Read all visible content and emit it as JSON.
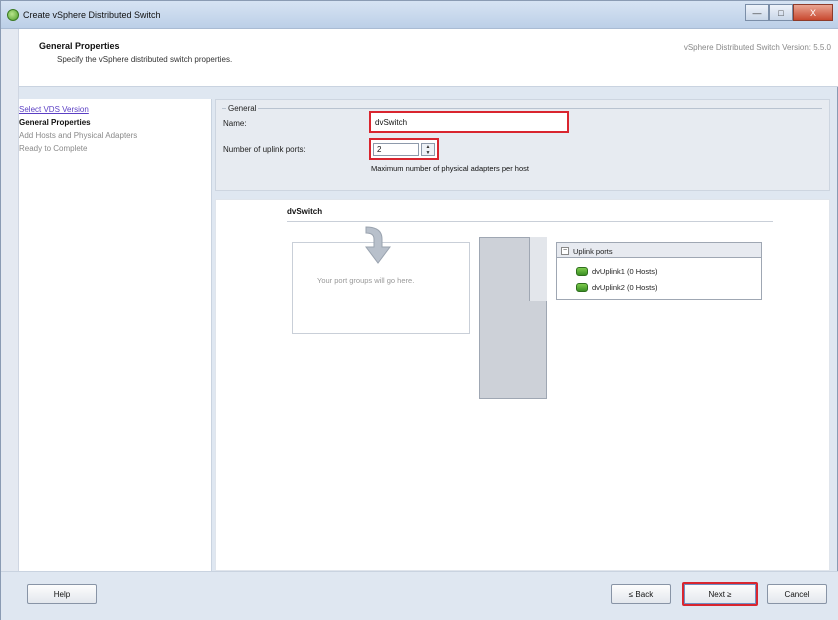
{
  "window": {
    "title": "Create vSphere Distributed Switch",
    "controls": [
      "—",
      "□",
      "X"
    ]
  },
  "header": {
    "title": "General Properties",
    "subtitle": "Specify the vSphere distributed switch properties.",
    "version": "vSphere Distributed Switch Version: 5.5.0"
  },
  "steps": [
    {
      "label": "Select VDS Version",
      "state": "link"
    },
    {
      "label": "General Properties",
      "state": "current"
    },
    {
      "label": "Add Hosts and Physical Adapters",
      "state": "future"
    },
    {
      "label": "Ready to Complete",
      "state": "future"
    }
  ],
  "general": {
    "legend": "General",
    "name_label": "Name:",
    "name_value": "dvSwitch",
    "uplink_label": "Number of uplink ports:",
    "uplink_value": "2",
    "uplink_hint": "Maximum number of physical adapters per host"
  },
  "diagram": {
    "switch_name": "dvSwitch",
    "portgroups_placeholder": "Your port groups will go here.",
    "uplink_title": "Uplink ports",
    "uplinks": [
      "dvUplink1 (0 Hosts)",
      "dvUplink2 (0 Hosts)"
    ]
  },
  "footer": {
    "help": "Help",
    "back": "≤ Back",
    "next": "Next ≥",
    "cancel": "Cancel"
  },
  "colors": {
    "highlight": "#d9252f",
    "link": "#5b3fc4"
  }
}
